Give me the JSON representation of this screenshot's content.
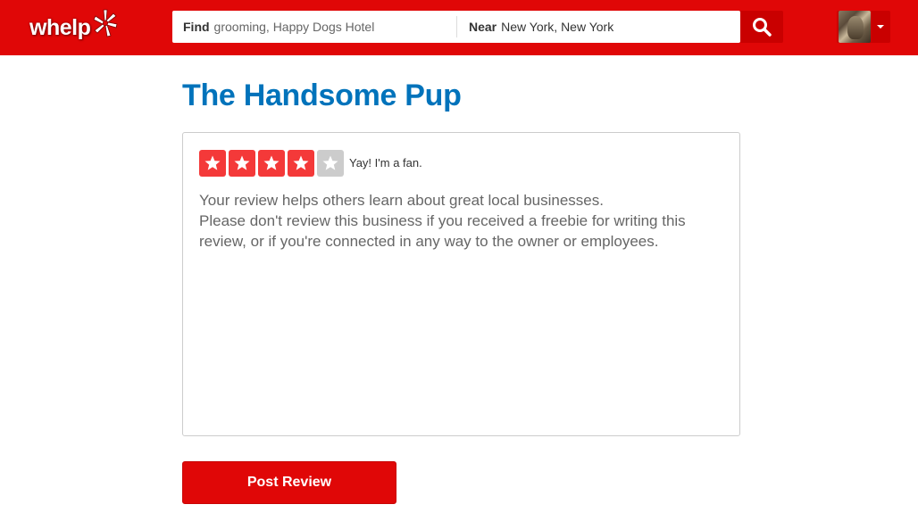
{
  "header": {
    "logo_text": "whelp",
    "brand_color": "#e00707",
    "search": {
      "find_label": "Find",
      "find_value": "grooming, Happy Dogs Hotel",
      "near_label": "Near",
      "near_value": "New York, New York",
      "button_icon": "search-icon"
    },
    "user_menu": {
      "avatar_icon": "avatar",
      "dropdown_icon": "chevron-down-icon"
    }
  },
  "main": {
    "business_name": "The Handsome Pup",
    "review": {
      "rating": 4,
      "max_rating": 5,
      "rating_text": "Yay! I'm a fan.",
      "placeholder_line1": "Your review helps others learn about great local businesses.",
      "placeholder_line2": "Please don't review this business if you received a freebie for writing this review, or if you're connected in any way to the owner or employees."
    },
    "post_button_label": "Post Review"
  }
}
